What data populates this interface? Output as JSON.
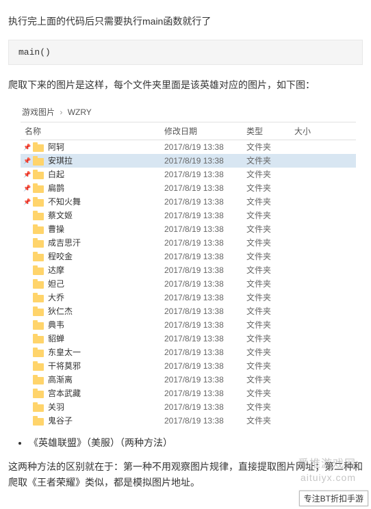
{
  "intro1": "执行完上面的代码后只需要执行main函数就行了",
  "code": "main()",
  "intro2": "爬取下来的图片是这样，每个文件夹里面是该英雄对应的图片，如下图：",
  "breadcrumb": {
    "parent": "游戏图片",
    "current": "WZRY"
  },
  "columns": {
    "name": "名称",
    "date": "修改日期",
    "type": "类型",
    "size": "大小"
  },
  "rows": [
    {
      "pin": true,
      "name": "阿轲",
      "date": "2017/8/19 13:38",
      "type": "文件夹",
      "selected": false
    },
    {
      "pin": true,
      "name": "安琪拉",
      "date": "2017/8/19 13:38",
      "type": "文件夹",
      "selected": true
    },
    {
      "pin": true,
      "name": "白起",
      "date": "2017/8/19 13:38",
      "type": "文件夹",
      "selected": false
    },
    {
      "pin": true,
      "name": "扁鹊",
      "date": "2017/8/19 13:38",
      "type": "文件夹",
      "selected": false
    },
    {
      "pin": true,
      "name": "不知火舞",
      "date": "2017/8/19 13:38",
      "type": "文件夹",
      "selected": false
    },
    {
      "pin": false,
      "name": "蔡文姬",
      "date": "2017/8/19 13:38",
      "type": "文件夹",
      "selected": false
    },
    {
      "pin": false,
      "name": "曹操",
      "date": "2017/8/19 13:38",
      "type": "文件夹",
      "selected": false
    },
    {
      "pin": false,
      "name": "成吉思汗",
      "date": "2017/8/19 13:38",
      "type": "文件夹",
      "selected": false
    },
    {
      "pin": false,
      "name": "程咬金",
      "date": "2017/8/19 13:38",
      "type": "文件夹",
      "selected": false
    },
    {
      "pin": false,
      "name": "达摩",
      "date": "2017/8/19 13:38",
      "type": "文件夹",
      "selected": false
    },
    {
      "pin": false,
      "name": "妲己",
      "date": "2017/8/19 13:38",
      "type": "文件夹",
      "selected": false
    },
    {
      "pin": false,
      "name": "大乔",
      "date": "2017/8/19 13:38",
      "type": "文件夹",
      "selected": false
    },
    {
      "pin": false,
      "name": "狄仁杰",
      "date": "2017/8/19 13:38",
      "type": "文件夹",
      "selected": false
    },
    {
      "pin": false,
      "name": "典韦",
      "date": "2017/8/19 13:38",
      "type": "文件夹",
      "selected": false
    },
    {
      "pin": false,
      "name": "貂蝉",
      "date": "2017/8/19 13:38",
      "type": "文件夹",
      "selected": false
    },
    {
      "pin": false,
      "name": "东皇太一",
      "date": "2017/8/19 13:38",
      "type": "文件夹",
      "selected": false
    },
    {
      "pin": false,
      "name": "干将莫邪",
      "date": "2017/8/19 13:38",
      "type": "文件夹",
      "selected": false
    },
    {
      "pin": false,
      "name": "高渐离",
      "date": "2017/8/19 13:38",
      "type": "文件夹",
      "selected": false
    },
    {
      "pin": false,
      "name": "宫本武藏",
      "date": "2017/8/19 13:38",
      "type": "文件夹",
      "selected": false
    },
    {
      "pin": false,
      "name": "关羽",
      "date": "2017/8/19 13:38",
      "type": "文件夹",
      "selected": false
    },
    {
      "pin": false,
      "name": "鬼谷子",
      "date": "2017/8/19 13:38",
      "type": "文件夹",
      "selected": false
    }
  ],
  "bullet": "《英雄联盟》（美服）（两种方法）",
  "closing": "这两种方法的区别就在于：第一种不用观察图片规律，直接提取图片网址；第二种和爬取《王者荣耀》类似，都是模拟图片地址。",
  "watermark1": "爱推游戏网",
  "watermark2": "aituiyx.com",
  "corner": "专注BT折扣手游"
}
